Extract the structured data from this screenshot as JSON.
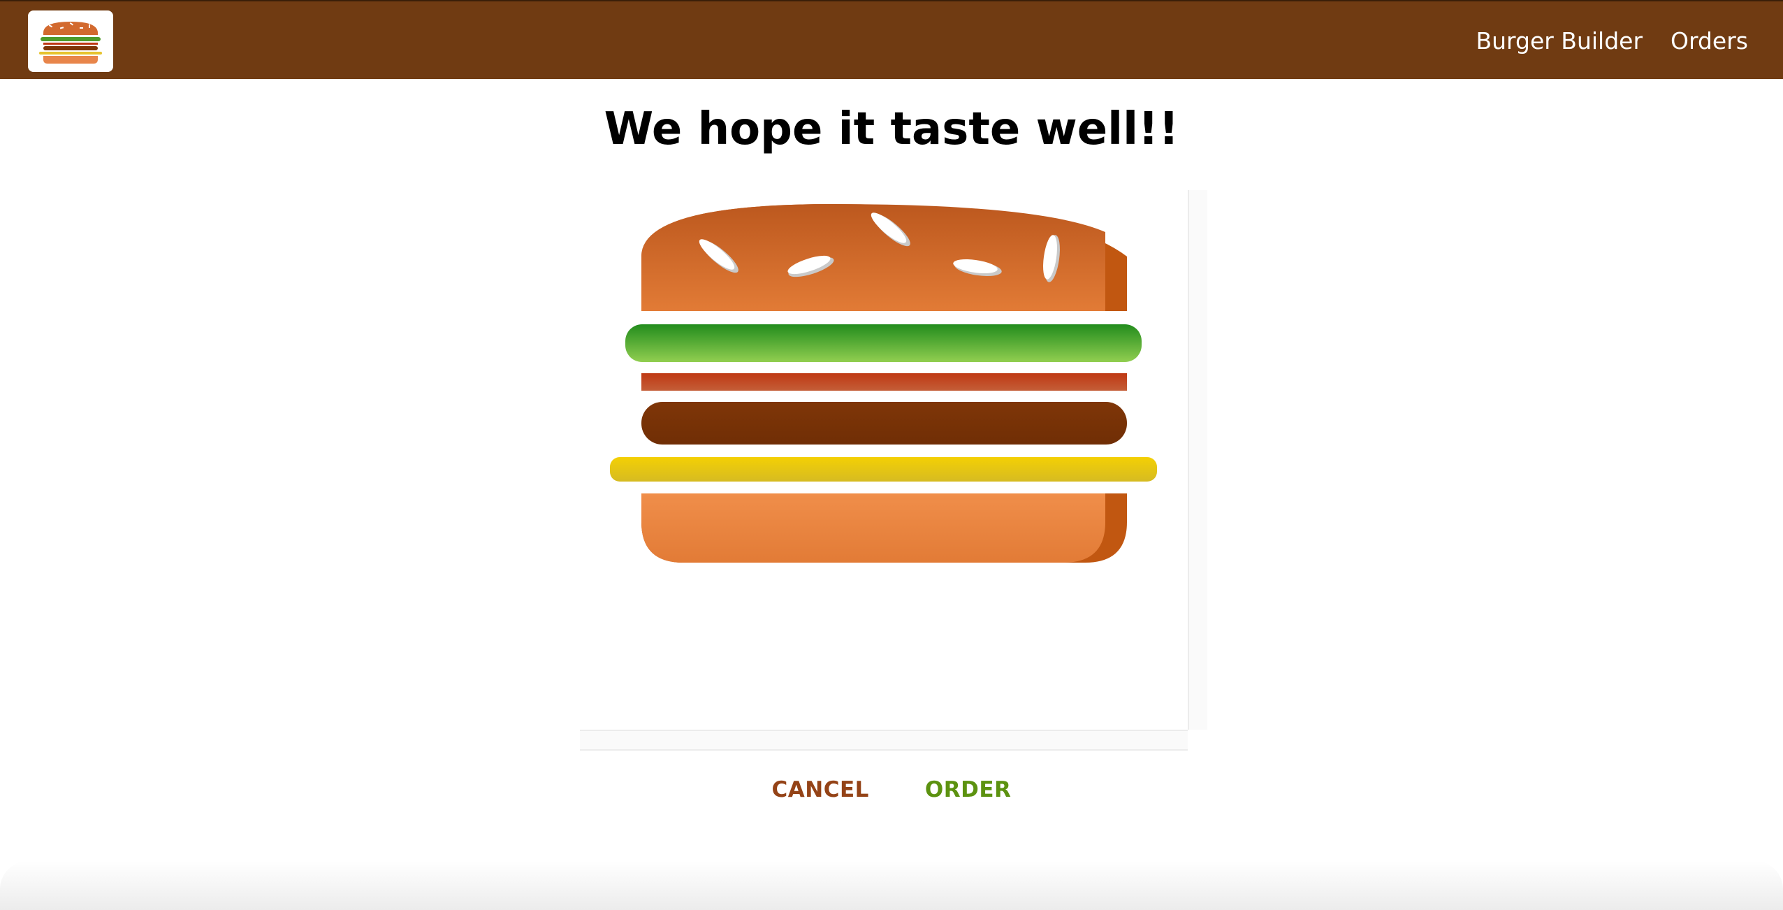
{
  "toolbar": {
    "logo_icon": "burger-logo-icon",
    "nav": [
      {
        "label": "Burger Builder"
      },
      {
        "label": "Orders"
      }
    ],
    "background": "#703B12"
  },
  "summary": {
    "title": "We hope it taste well!!"
  },
  "burger": {
    "layers": [
      "bread-top",
      "salad",
      "bacon",
      "meat",
      "cheese",
      "bread-bottom"
    ],
    "colors": {
      "bread": "#E27B36",
      "salad": "#4E9B2B",
      "bacon": "#BF3813",
      "meat": "#7F3608",
      "cheese": "#E6C32E"
    }
  },
  "actions": {
    "cancel_label": "CANCEL",
    "order_label": "ORDER",
    "cancel_color": "#944317",
    "order_color": "#5C9210"
  }
}
